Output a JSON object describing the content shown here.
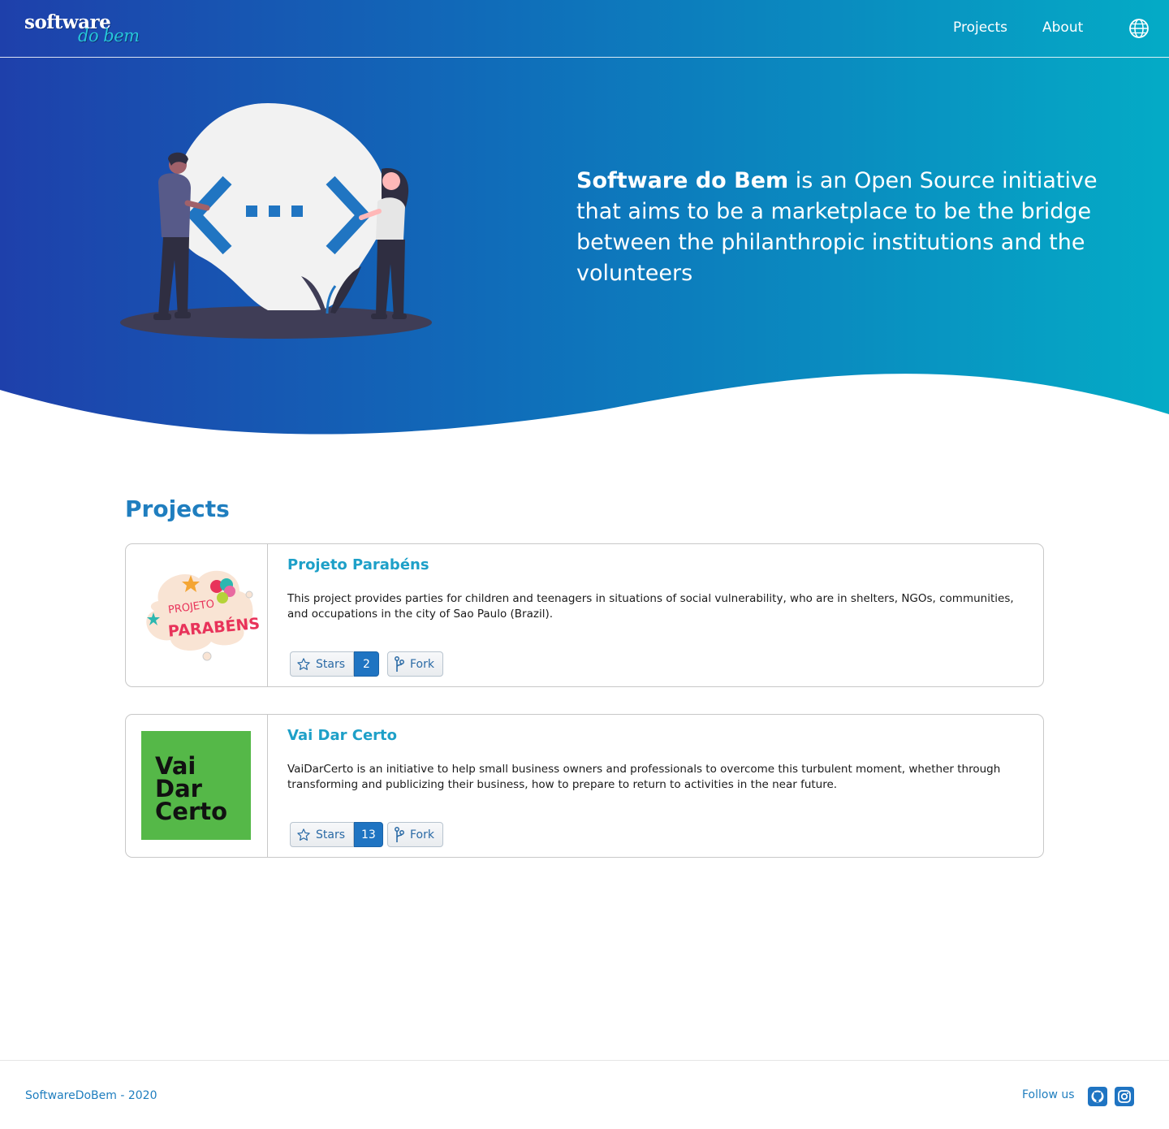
{
  "brand": {
    "logo_top": "software",
    "logo_bottom": "do bem"
  },
  "nav": {
    "projects": "Projects",
    "about": "About",
    "language_icon": "globe-icon"
  },
  "hero": {
    "name": "Software do Bem",
    "tagline": " is an Open Source initiative that aims to be a marketplace to be the bridge between the philanthropic institutions and the volunteers"
  },
  "projects_section": {
    "title": "Projects"
  },
  "projects": [
    {
      "title": "Projeto Parabéns",
      "description": "This project provides parties for children and teenagers in situations of social vulnerability, who are in shelters, NGOs, communities, and occupations in the city of Sao Paulo (Brazil).",
      "logo_text_top": "PROJETO",
      "logo_text_bottom": "PARABÉNS",
      "stars_label": "Stars",
      "stars_count": "2",
      "fork_label": "Fork"
    },
    {
      "title": "Vai Dar Certo",
      "description": "VaiDarCerto is an initiative to help small business owners and professionals to overcome this turbulent moment, whether through transforming and publicizing their business, how to prepare to return to activities in the near future.",
      "logo_lines": [
        "Vai",
        "Dar",
        "Certo"
      ],
      "stars_label": "Stars",
      "stars_count": "13",
      "fork_label": "Fork"
    }
  ],
  "footer": {
    "copyright": "SoftwareDoBem - 2020",
    "follow": "Follow us",
    "social_icons": [
      "github-icon",
      "instagram-icon"
    ]
  },
  "colors": {
    "gradient_start": "#1e40ab",
    "gradient_end": "#04abc6",
    "heading_blue": "#1f7ebf",
    "card_title": "#1ea0c8",
    "count_badge": "#1f74c2",
    "vdc_green": "#55b848"
  }
}
